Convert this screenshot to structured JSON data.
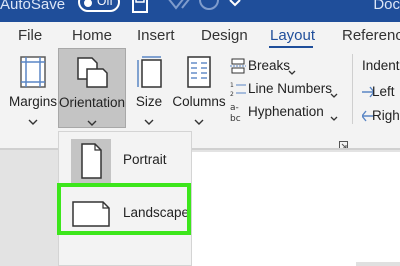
{
  "titlebar": {
    "autosave_label": "AutoSave",
    "autosave_state": "Off",
    "doc_title": "Doc"
  },
  "tabs": [
    {
      "label": "File"
    },
    {
      "label": "Home"
    },
    {
      "label": "Insert"
    },
    {
      "label": "Design"
    },
    {
      "label": "Layout",
      "active": true
    },
    {
      "label": "References"
    }
  ],
  "ribbon": {
    "margins": "Margins",
    "orientation": "Orientation",
    "size": "Size",
    "columns": "Columns",
    "breaks": "Breaks",
    "line_numbers": "Line Numbers",
    "hyphenation": "Hyphenation",
    "indent": "Indent",
    "left": "Left",
    "right": "Right"
  },
  "orientation_menu": {
    "portrait": "Portrait",
    "landscape": "Landscape"
  },
  "colors": {
    "titlebar": "#1f4e9a",
    "ribbon": "#f3f3f3",
    "selected_button": "#c4c4c4",
    "highlight": "#3ce61b"
  }
}
